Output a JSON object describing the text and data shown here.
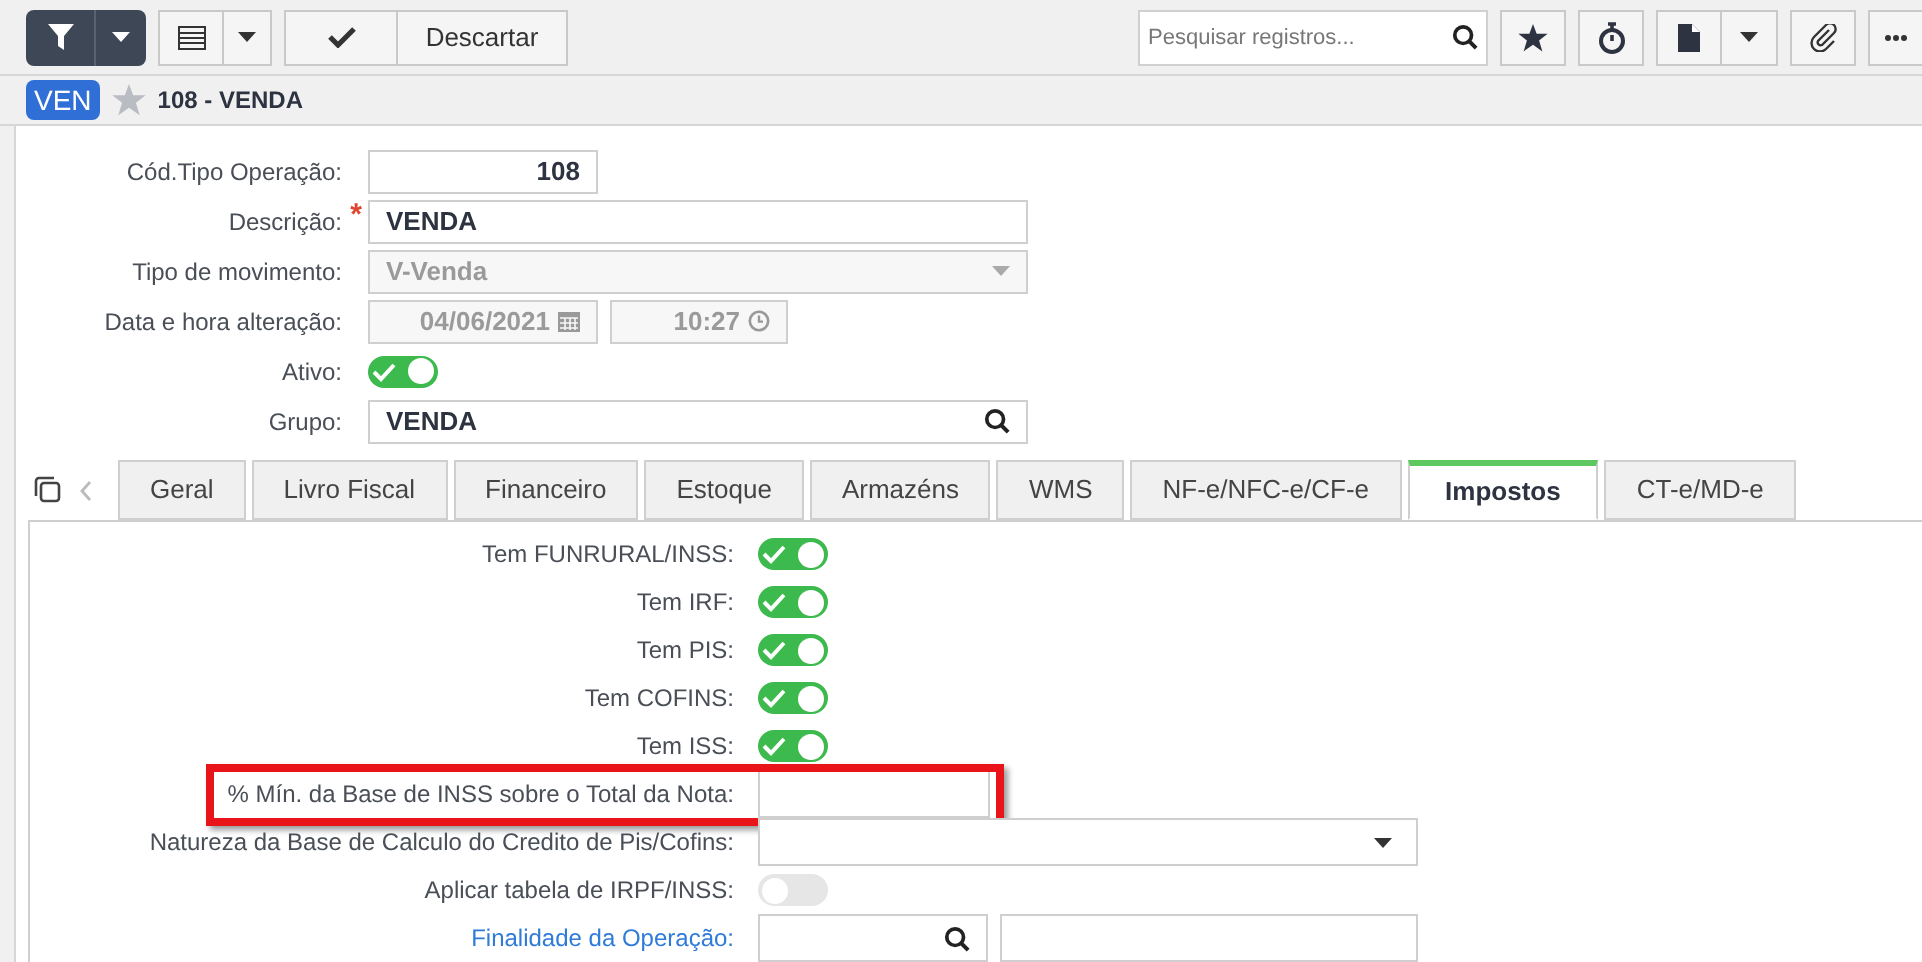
{
  "toolbar": {
    "discard_label": "Descartar",
    "search": {
      "placeholder": "Pesquisar registros..."
    }
  },
  "record": {
    "badge": "VEN",
    "title": "108 - VENDA",
    "favorite": false
  },
  "form": {
    "fields": [
      {
        "kind": "number",
        "label": "Cód.Tipo Operação:",
        "value": "108"
      },
      {
        "kind": "text",
        "label": "Descrição:",
        "required_mark": "*",
        "value": "VENDA"
      },
      {
        "kind": "select",
        "label": "Tipo de movimento:",
        "value": "V-Venda",
        "disabled": true
      },
      {
        "kind": "datetime",
        "label": "Data e hora alteração:",
        "date": "04/06/2021",
        "time": "10:27",
        "disabled": true
      },
      {
        "kind": "toggle",
        "label": "Ativo:",
        "on": true
      },
      {
        "kind": "lookup",
        "label": "Grupo:",
        "value": "VENDA"
      }
    ]
  },
  "tabs": [
    {
      "label": "Geral",
      "selected": false
    },
    {
      "label": "Livro Fiscal",
      "selected": false
    },
    {
      "label": "Financeiro",
      "selected": false
    },
    {
      "label": "Estoque",
      "selected": false
    },
    {
      "label": "Armazéns",
      "selected": false
    },
    {
      "label": "WMS",
      "selected": false
    },
    {
      "label": "NF-e/NFC-e/CF-e",
      "selected": false
    },
    {
      "label": "Impostos",
      "selected": true
    },
    {
      "label": "CT-e/MD-e",
      "selected": false
    }
  ],
  "tab_fields": [
    {
      "kind": "toggle",
      "label": "Tem FUNRURAL/INSS:",
      "on": true,
      "link": false,
      "highlighted": false
    },
    {
      "kind": "toggle",
      "label": "Tem IRF:",
      "on": true,
      "link": false,
      "highlighted": false
    },
    {
      "kind": "toggle",
      "label": "Tem PIS:",
      "on": true,
      "link": false,
      "highlighted": false
    },
    {
      "kind": "toggle",
      "label": "Tem COFINS:",
      "on": true,
      "link": false,
      "highlighted": false
    },
    {
      "kind": "toggle",
      "label": "Tem ISS:",
      "on": true,
      "link": false,
      "highlighted": false
    },
    {
      "kind": "text",
      "label": "% Mín. da Base de INSS sobre o Total da Nota:",
      "link": false,
      "highlighted": true
    },
    {
      "kind": "select",
      "label": "Natureza da Base de Calculo do Credito de Pis/Cofins:",
      "link": false,
      "highlighted": false
    },
    {
      "kind": "toggle",
      "label": "Aplicar tabela de IRPF/INSS:",
      "on": false,
      "link": false,
      "highlighted": false
    },
    {
      "kind": "lookup",
      "label": "Finalidade da Operação:",
      "link": true,
      "highlighted": false
    }
  ]
}
